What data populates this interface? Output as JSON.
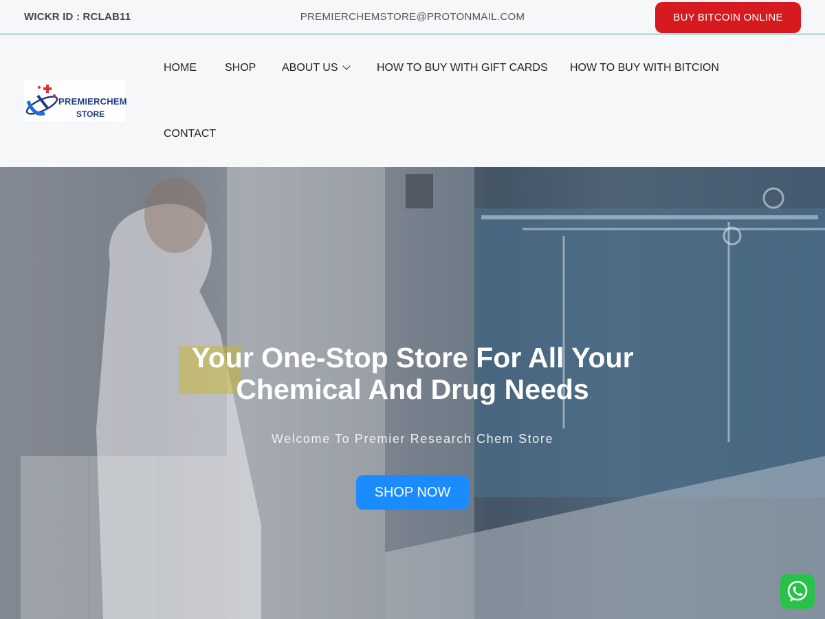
{
  "topbar": {
    "wickr_label": "WICKR ID :  RCLAB11",
    "email": "PREMIERCHEMSTORE@PROTONMAIL.COM",
    "cta_label": "BUY BITCOIN ONLINE"
  },
  "logo": {
    "line1": "PREMIERCHEM",
    "line2": "STORE"
  },
  "nav": {
    "home": "HOME",
    "shop": "SHOP",
    "about": "ABOUT US",
    "gift": "HOW TO BUY WITH GIFT CARDS",
    "bitcoin": "HOW TO BUY WITH BITCION",
    "contact": "CONTACT"
  },
  "hero": {
    "title_line1": "Your One-Stop Store For All Your",
    "title_line2": "Chemical And Drug Needs",
    "subtitle": "Welcome To Premier Research Chem Store",
    "button": "SHOP NOW"
  },
  "icons": {
    "chevron": "chevron-down-icon",
    "whatsapp": "whatsapp-icon"
  },
  "colors": {
    "cta_red": "#d61a1f",
    "shop_blue": "#1a8cff",
    "whatsapp_green": "#27c24a",
    "divider_teal": "#3aa1a6"
  }
}
